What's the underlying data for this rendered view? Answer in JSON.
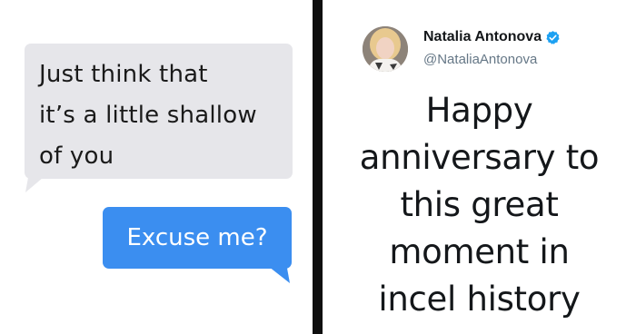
{
  "chat": {
    "incoming_lines": [
      "Just think that",
      "it’s a little shallow",
      "of you"
    ],
    "outgoing": "Excuse me?",
    "colors": {
      "incoming_bg": "#e6e6ea",
      "outgoing_bg": "#3b8ef0"
    }
  },
  "tweet": {
    "display_name": "Natalia Antonova",
    "handle": "@NataliaAntonova",
    "verified_icon": "verified-badge-icon",
    "text_lines": [
      "Happy",
      "anniversary to",
      "this great",
      "moment in",
      "incel history"
    ]
  }
}
